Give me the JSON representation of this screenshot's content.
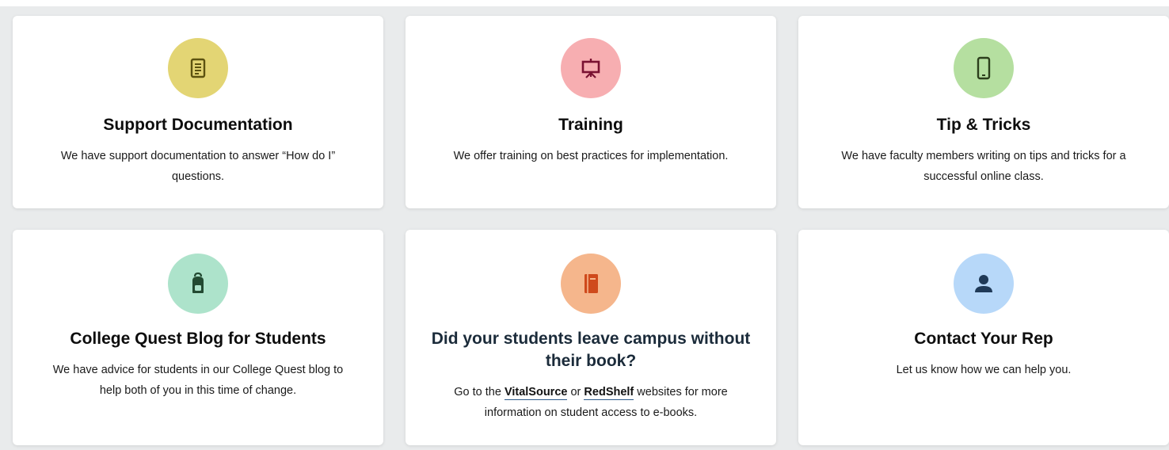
{
  "cards": [
    {
      "title": "Support Documentation",
      "description": "We have support documentation to answer “How do I” questions.",
      "icon": "document-icon",
      "icon_bg": "#e3d574",
      "icon_color": "#5c5210"
    },
    {
      "title": "Training",
      "description": "We offer training on best practices for implementation.",
      "icon": "presentation-board-icon",
      "icon_bg": "#f7aeb1",
      "icon_color": "#7a1232"
    },
    {
      "title": "Tip & Tricks",
      "description": "We have faculty members writing on tips and tricks for a successful online class.",
      "icon": "mobile-phone-icon",
      "icon_bg": "#b5dfa0",
      "icon_color": "#2c3f1c"
    },
    {
      "title": "College Quest Blog for Students",
      "description": "We have advice for students in our College Quest blog to help both of you in this time of change.",
      "icon": "backpack-icon",
      "icon_bg": "#ade3cb",
      "icon_color": "#234a32"
    },
    {
      "title": "Did your students leave campus without their book?",
      "description_prefix": "Go to the ",
      "link1": "VitalSource",
      "description_mid": " or ",
      "link2": "RedShelf",
      "description_suffix": " websites for more information on student access to e-books.",
      "icon": "book-icon",
      "icon_bg": "#f5b68c",
      "icon_color": "#cf4a1c"
    },
    {
      "title": "Contact Your Rep",
      "description": "Let us know how we can help you.",
      "icon": "person-icon",
      "icon_bg": "#b7d8f9",
      "icon_color": "#1f3a58"
    }
  ]
}
